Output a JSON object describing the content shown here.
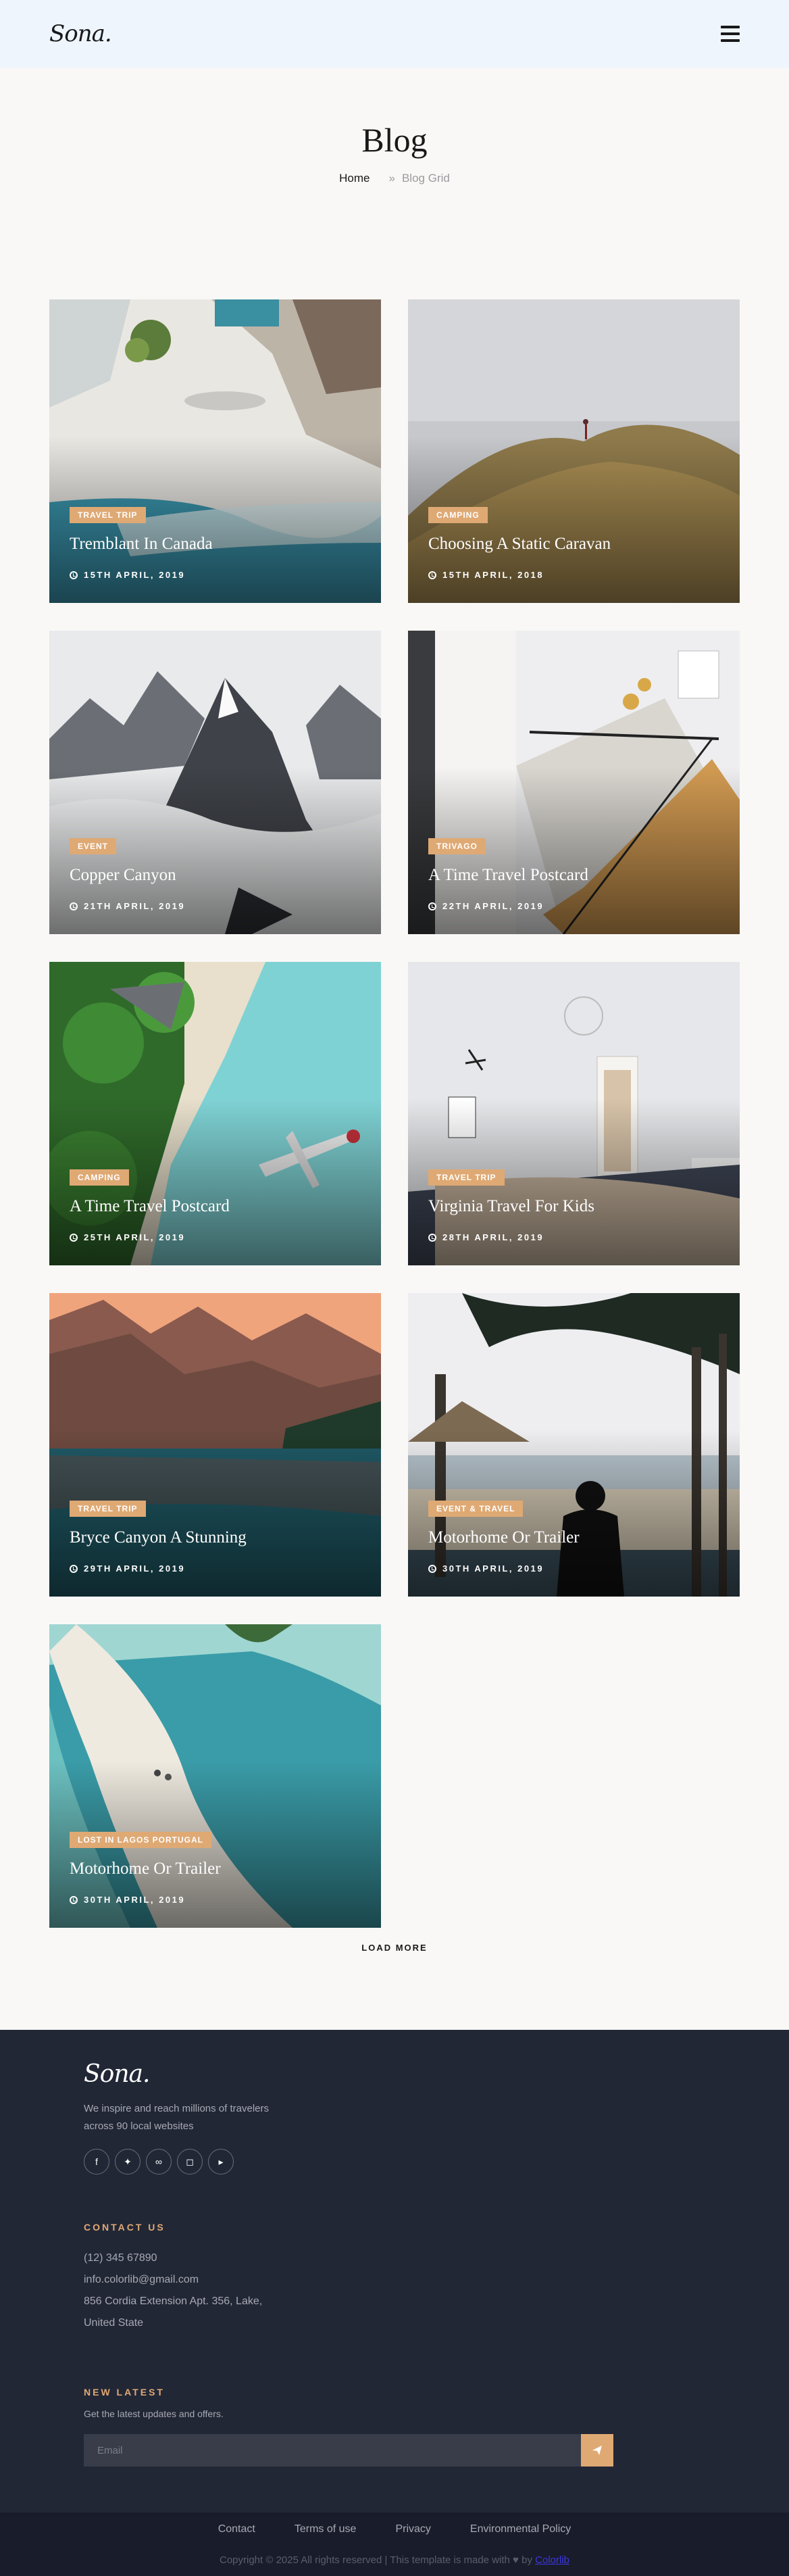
{
  "header": {
    "logo": "Sona.",
    "menu_icon": "hamburger-icon"
  },
  "page": {
    "title": "Blog",
    "breadcrumb": {
      "home": "Home",
      "separator": "»",
      "current": "Blog Grid"
    }
  },
  "posts": [
    {
      "tag": "Travel Trip",
      "title": "Tremblant In Canada",
      "date": "15th April, 2019"
    },
    {
      "tag": "Camping",
      "title": "Choosing A Static Caravan",
      "date": "15th April, 2018"
    },
    {
      "tag": "Event",
      "title": "Copper Canyon",
      "date": "21th April, 2019"
    },
    {
      "tag": "Trivago",
      "title": "A Time Travel Postcard",
      "date": "22th April, 2019"
    },
    {
      "tag": "Camping",
      "title": "A Time Travel Postcard",
      "date": "25th April, 2019"
    },
    {
      "tag": "Travel Trip",
      "title": "Virginia Travel For Kids",
      "date": "28th April, 2019"
    },
    {
      "tag": "Travel Trip",
      "title": "Bryce Canyon A Stunning",
      "date": "29th April, 2019"
    },
    {
      "tag": "Event & Travel",
      "title": "Motorhome Or Trailer",
      "date": "30th April, 2019"
    },
    {
      "tag": "Lost In Lagos Portugal",
      "title": "Motorhome Or Trailer",
      "date": "30th April, 2019"
    }
  ],
  "load_more": "LOAD MORE",
  "footer": {
    "logo": "Sona.",
    "about": "We inspire and reach millions of travelers across 90 local websites",
    "socials": [
      "facebook-icon",
      "twitter-icon",
      "tripadvisor-icon",
      "instagram-icon",
      "youtube-icon"
    ],
    "contact": {
      "heading": "CONTACT US",
      "phone": "(12) 345 67890",
      "email": "info.colorlib@gmail.com",
      "address1": "856 Cordia Extension Apt. 356, Lake,",
      "address2": "United State"
    },
    "newsletter": {
      "heading": "NEW LATEST",
      "text": "Get the latest updates and offers.",
      "placeholder": "Email"
    },
    "links": [
      "Contact",
      "Terms of use",
      "Privacy",
      "Environmental Policy"
    ],
    "copyright": "Copyright © 2025 All rights reserved | This template is made with",
    "by_text": "by",
    "by_link": "Colorlib"
  },
  "colors": {
    "accent": "#dfa974",
    "footer_bg": "#222736",
    "bottom_bg": "#191c2b",
    "header_bg": "#eef5fd"
  }
}
